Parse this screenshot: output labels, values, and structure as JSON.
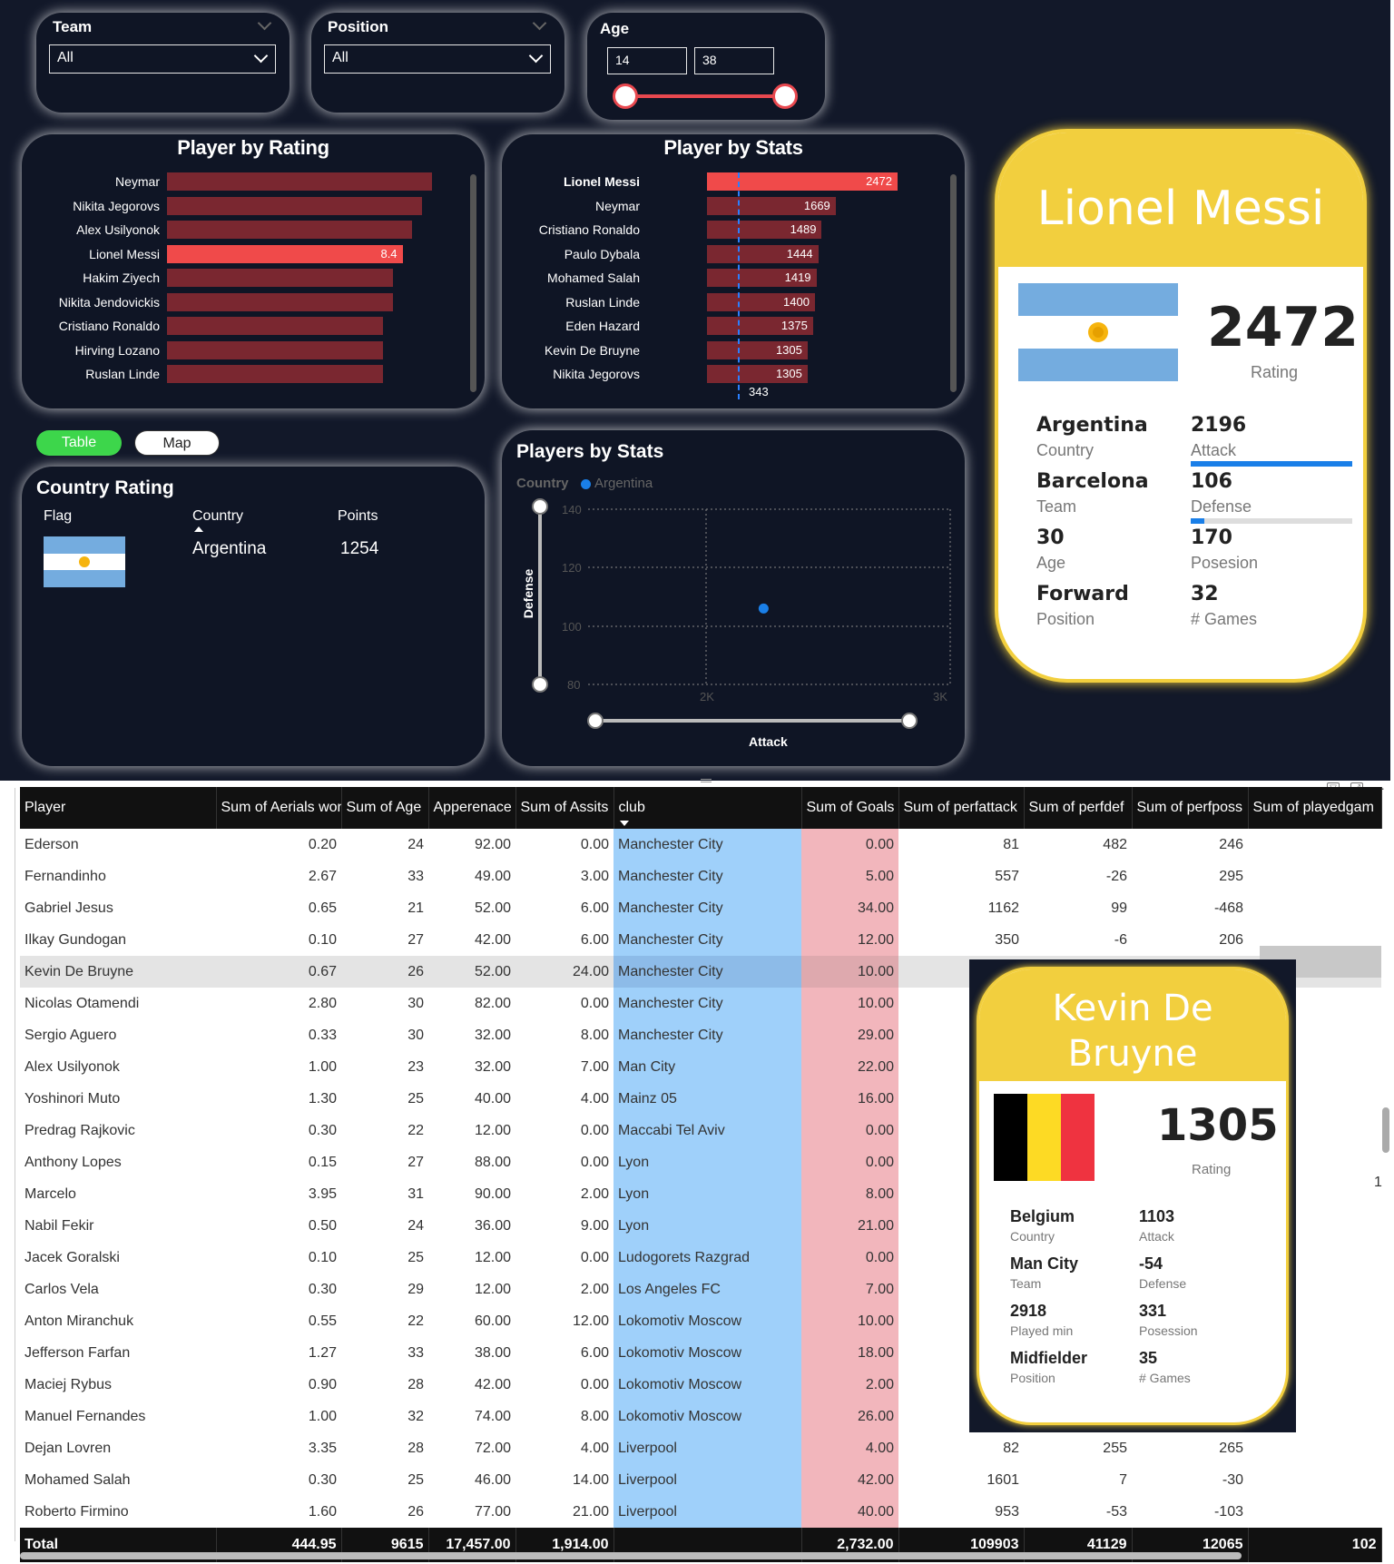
{
  "filters": {
    "team": {
      "label": "Team",
      "value": "All"
    },
    "position": {
      "label": "Position",
      "value": "All"
    },
    "age": {
      "label": "Age",
      "min": "14",
      "max": "38"
    }
  },
  "rating_chart": {
    "title": "Player by Rating",
    "rows": [
      {
        "name": "Neymar",
        "value": 8.7,
        "label": ""
      },
      {
        "name": "Nikita Jegorovs",
        "value": 8.6,
        "label": ""
      },
      {
        "name": "Alex Usilyonok",
        "value": 8.5,
        "label": ""
      },
      {
        "name": "Lionel Messi",
        "value": 8.4,
        "label": "8.4",
        "highlight": true
      },
      {
        "name": "Hakim Ziyech",
        "value": 8.3,
        "label": ""
      },
      {
        "name": "Nikita Jendovickis",
        "value": 8.3,
        "label": ""
      },
      {
        "name": "Cristiano Ronaldo",
        "value": 8.2,
        "label": ""
      },
      {
        "name": "Hirving Lozano",
        "value": 8.2,
        "label": ""
      },
      {
        "name": "Ruslan Linde",
        "value": 8.2,
        "label": ""
      }
    ]
  },
  "stats_chart": {
    "title": "Player by Stats",
    "avg_label": "343",
    "rows": [
      {
        "name": "Lionel Messi",
        "value": 2472,
        "highlight": true
      },
      {
        "name": "Neymar",
        "value": 1669
      },
      {
        "name": "Cristiano Ronaldo",
        "value": 1489
      },
      {
        "name": "Paulo Dybala",
        "value": 1444
      },
      {
        "name": "Mohamed Salah",
        "value": 1419
      },
      {
        "name": "Ruslan Linde",
        "value": 1400
      },
      {
        "name": "Eden Hazard",
        "value": 1375
      },
      {
        "name": "Kevin De Bruyne",
        "value": 1305
      },
      {
        "name": "Nikita Jegorovs",
        "value": 1305
      }
    ]
  },
  "toggles": {
    "table": "Table",
    "map": "Map"
  },
  "country_rating": {
    "title": "Country Rating",
    "headers": {
      "flag": "Flag",
      "country": "Country",
      "points": "Points"
    },
    "country": "Argentina",
    "points": "1254"
  },
  "scatter": {
    "title": "Players by Stats",
    "legend_title": "Country",
    "legend_item": "Argentina",
    "y_label": "Defense",
    "x_label": "Attack",
    "y_ticks": [
      "140",
      "120",
      "100",
      "80"
    ],
    "x_ticks": [
      "2K",
      "3K"
    ],
    "point": {
      "attack": 2196,
      "defense": 106
    },
    "color": "#1a7fe8"
  },
  "messi_card": {
    "name": "Lionel Messi",
    "rating": "2472",
    "rating_label": "Rating",
    "country": "Argentina",
    "country_label": "Country",
    "team": "Barcelona",
    "team_label": "Team",
    "age": "30",
    "age_label": "Age",
    "position": "Forward",
    "position_label": "Position",
    "attack": "2196",
    "attack_label": "Attack",
    "defense": "106",
    "defense_label": "Defense",
    "possession": "170",
    "possession_label": "Posesion",
    "games": "32",
    "games_label": "# Games"
  },
  "kdb_card": {
    "name_line1": "Kevin De",
    "name_line2": "Bruyne",
    "rating": "1305",
    "rating_label": "Rating",
    "country": "Belgium",
    "country_label": "Country",
    "team": "Man City",
    "team_label": "Team",
    "played_min": "2918",
    "played_min_label": "Played min",
    "position": "Midfielder",
    "position_label": "Position",
    "attack": "1103",
    "attack_label": "Attack",
    "defense": "-54",
    "defense_label": "Defense",
    "possession": "331",
    "possession_label": "Posession",
    "games": "35",
    "games_label": "# Games"
  },
  "table": {
    "columns": [
      "Player",
      "Sum of Aerials won",
      "Sum of Age",
      "Apperenace",
      "Sum of Assits",
      "club",
      "Sum of Goals",
      "Sum of perfattack",
      "Sum of perfdef",
      "Sum of perfposs",
      "Sum of playedgam"
    ],
    "rows": [
      [
        "Ederson",
        "0.20",
        "24",
        "92.00",
        "0.00",
        "Manchester City",
        "0.00",
        "81",
        "482",
        "246"
      ],
      [
        "Fernandinho",
        "2.67",
        "33",
        "49.00",
        "3.00",
        "Manchester City",
        "5.00",
        "557",
        "-26",
        "295"
      ],
      [
        "Gabriel Jesus",
        "0.65",
        "21",
        "52.00",
        "6.00",
        "Manchester City",
        "34.00",
        "1162",
        "99",
        "-468"
      ],
      [
        "Ilkay Gundogan",
        "0.10",
        "27",
        "42.00",
        "6.00",
        "Manchester City",
        "12.00",
        "350",
        "-6",
        "206"
      ],
      [
        "Kevin De Bruyne",
        "0.67",
        "26",
        "52.00",
        "24.00",
        "Manchester City",
        "10.00",
        "",
        "",
        ""
      ],
      [
        "Nicolas Otamendi",
        "2.80",
        "30",
        "82.00",
        "0.00",
        "Manchester City",
        "10.00",
        "",
        "",
        ""
      ],
      [
        "Sergio Aguero",
        "0.33",
        "30",
        "32.00",
        "8.00",
        "Manchester City",
        "29.00",
        "",
        "",
        ""
      ],
      [
        "Alex Usilyonok",
        "1.00",
        "23",
        "32.00",
        "7.00",
        "Man City",
        "22.00",
        "",
        "",
        ""
      ],
      [
        "Yoshinori Muto",
        "1.30",
        "25",
        "40.00",
        "4.00",
        "Mainz 05",
        "16.00",
        "",
        "",
        ""
      ],
      [
        "Predrag Rajkovic",
        "0.30",
        "22",
        "12.00",
        "0.00",
        "Maccabi Tel Aviv",
        "0.00",
        "",
        "",
        ""
      ],
      [
        "Anthony Lopes",
        "0.15",
        "27",
        "88.00",
        "0.00",
        "Lyon",
        "0.00",
        "",
        "",
        ""
      ],
      [
        "Marcelo",
        "3.95",
        "31",
        "90.00",
        "2.00",
        "Lyon",
        "8.00",
        "",
        "",
        ""
      ],
      [
        "Nabil Fekir",
        "0.50",
        "24",
        "36.00",
        "9.00",
        "Lyon",
        "21.00",
        "",
        "",
        ""
      ],
      [
        "Jacek Goralski",
        "0.10",
        "25",
        "12.00",
        "0.00",
        "Ludogorets Razgrad",
        "0.00",
        "",
        "",
        ""
      ],
      [
        "Carlos Vela",
        "0.30",
        "29",
        "12.00",
        "2.00",
        "Los Angeles FC",
        "7.00",
        "",
        "",
        ""
      ],
      [
        "Anton Miranchuk",
        "0.55",
        "22",
        "60.00",
        "12.00",
        "Lokomotiv Moscow",
        "10.00",
        "",
        "",
        ""
      ],
      [
        "Jefferson Farfan",
        "1.27",
        "33",
        "38.00",
        "6.00",
        "Lokomotiv Moscow",
        "18.00",
        "",
        "",
        ""
      ],
      [
        "Maciej Rybus",
        "0.90",
        "28",
        "42.00",
        "0.00",
        "Lokomotiv Moscow",
        "2.00",
        "",
        "",
        ""
      ],
      [
        "Manuel Fernandes",
        "1.00",
        "32",
        "74.00",
        "8.00",
        "Lokomotiv Moscow",
        "26.00",
        "",
        "",
        ""
      ],
      [
        "Dejan Lovren",
        "3.35",
        "28",
        "72.00",
        "4.00",
        "Liverpool",
        "4.00",
        "82",
        "255",
        "265"
      ],
      [
        "Mohamed Salah",
        "0.30",
        "25",
        "46.00",
        "14.00",
        "Liverpool",
        "42.00",
        "1601",
        "7",
        "-30"
      ],
      [
        "Roberto Firmino",
        "1.60",
        "26",
        "77.00",
        "21.00",
        "Liverpool",
        "40.00",
        "953",
        "-53",
        "-103"
      ]
    ],
    "total": [
      "Total",
      "444.95",
      "9615",
      "17,457.00",
      "1,914.00",
      "",
      "2,732.00",
      "109903",
      "41129",
      "12065",
      "102"
    ],
    "marcelo_extra": "1"
  }
}
